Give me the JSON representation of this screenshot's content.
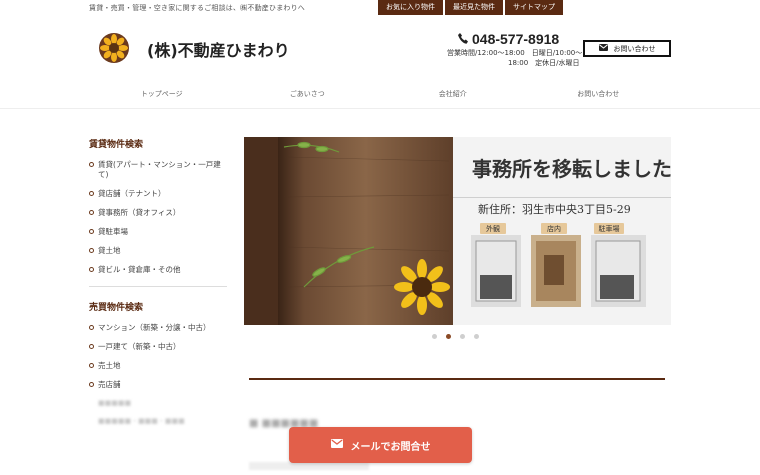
{
  "header": {
    "tagline": "賃貸・売買・管理・空き家に関するご相談は、㈱不動産ひまわりへ",
    "top_links": [
      "お気に入り物件",
      "最近見た物件",
      "サイトマップ"
    ],
    "brand": "(株)不動産ひまわり",
    "phone": "048-577-8918",
    "hours_line1": "営業時間/12:00～18:00　日曜日/10:00～",
    "hours_line2": "18:00　定休日/水曜日",
    "contact_label": "お問い合わせ"
  },
  "nav": [
    "トップページ",
    "ごあいさつ",
    "会社紹介",
    "お問い合わせ"
  ],
  "sidebar": {
    "rent_title": "賃貸物件検索",
    "rent_items": [
      "賃貸(アパート・マンション・一戸建て)",
      "貸店舗（テナント）",
      "貸事務所（貸オフィス）",
      "貸駐車場",
      "貸土地",
      "貸ビル・貸倉庫・その他"
    ],
    "sale_title": "売買物件検索",
    "sale_items": [
      "マンション（新築・分譲・中古）",
      "一戸建て（新築・中古）",
      "売土地",
      "売店舗"
    ],
    "blurred_items": [
      "■■■■■",
      "■■■■■・■■■・■■■"
    ]
  },
  "slider": {
    "headline": "事務所を移転しました",
    "address": "新住所：羽生市中央3丁目5-29",
    "photo_labels": [
      "外観",
      "店内",
      "駐車場"
    ],
    "dot_count": 4,
    "active_dot": 1
  },
  "footer_cta": {
    "mail_label": "メールでお問合せ"
  },
  "colors": {
    "brand_brown": "#5a2a12",
    "cta_red": "#e25f4a"
  }
}
